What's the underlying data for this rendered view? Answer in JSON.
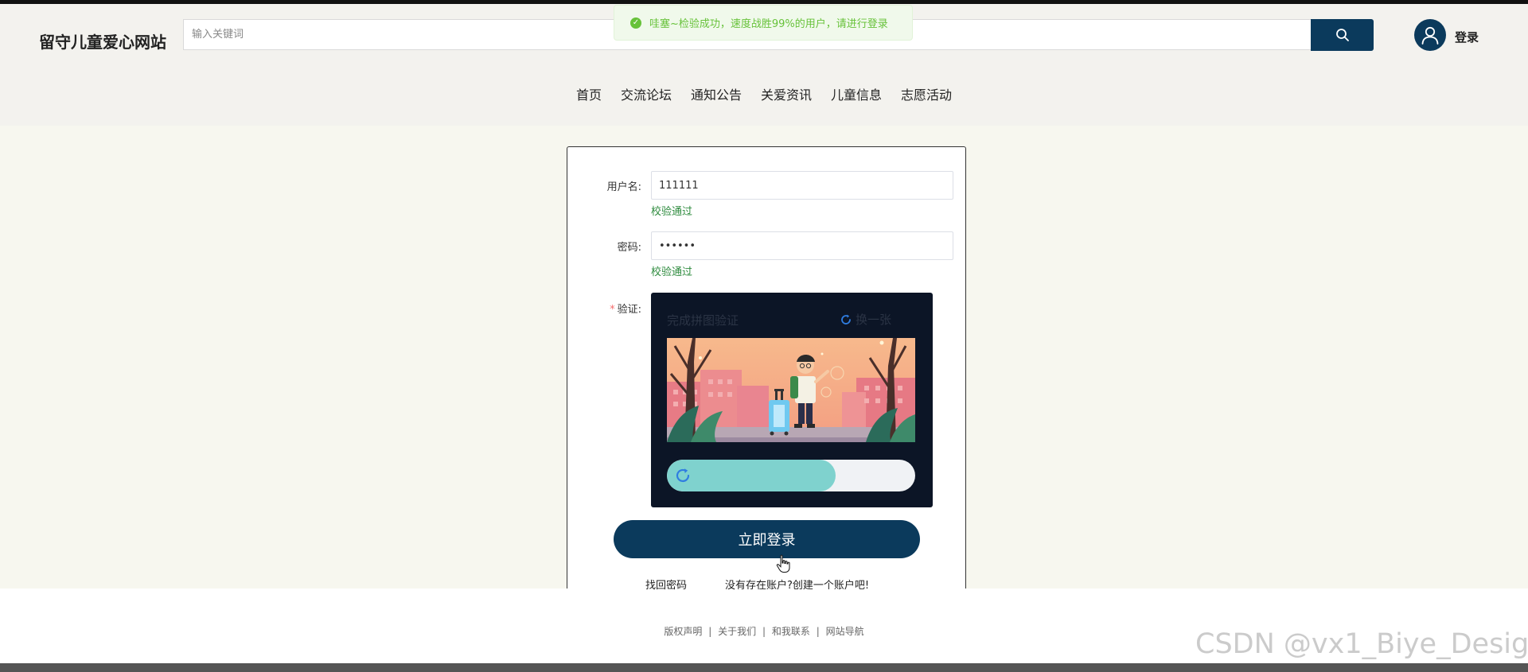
{
  "header": {
    "site_title": "留守儿童爱心网站",
    "search_placeholder": "输入关键词",
    "login_label": "登录",
    "toast_message": "哇塞~检验成功，速度战胜99%的用户，请进行登录"
  },
  "nav": {
    "items": [
      "首页",
      "交流论坛",
      "通知公告",
      "关爱资讯",
      "儿童信息",
      "志愿活动"
    ]
  },
  "login_form": {
    "username_label": "用户名:",
    "username_value": "111111",
    "username_status": "校验通过",
    "password_label": "密码:",
    "password_value": "••••••",
    "password_status": "校验通过",
    "captcha_required_mark": "*",
    "captcha_label": "验证:",
    "captcha_title": "完成拼图验证",
    "captcha_refresh_label": "换一张",
    "slider_progress": 0.68,
    "submit_label": "立即登录",
    "forgot_password": "找回密码",
    "register_prompt": "没有存在账户?创建一个账户吧!"
  },
  "footer": {
    "links": [
      "版权声明",
      "关于我们",
      "和我联系",
      "网站导航"
    ],
    "separator": "|"
  },
  "watermark": "CSDN @vx1_Biye_Design",
  "colors": {
    "primary": "#0b3a5c",
    "header_bg": "#f3f2ee",
    "page_bg": "#f7f7ef",
    "success": "#67c23a",
    "valid_text": "#2e8b3e",
    "captcha_bg": "#0c1526",
    "slider_fill": "#7fd2ce"
  }
}
